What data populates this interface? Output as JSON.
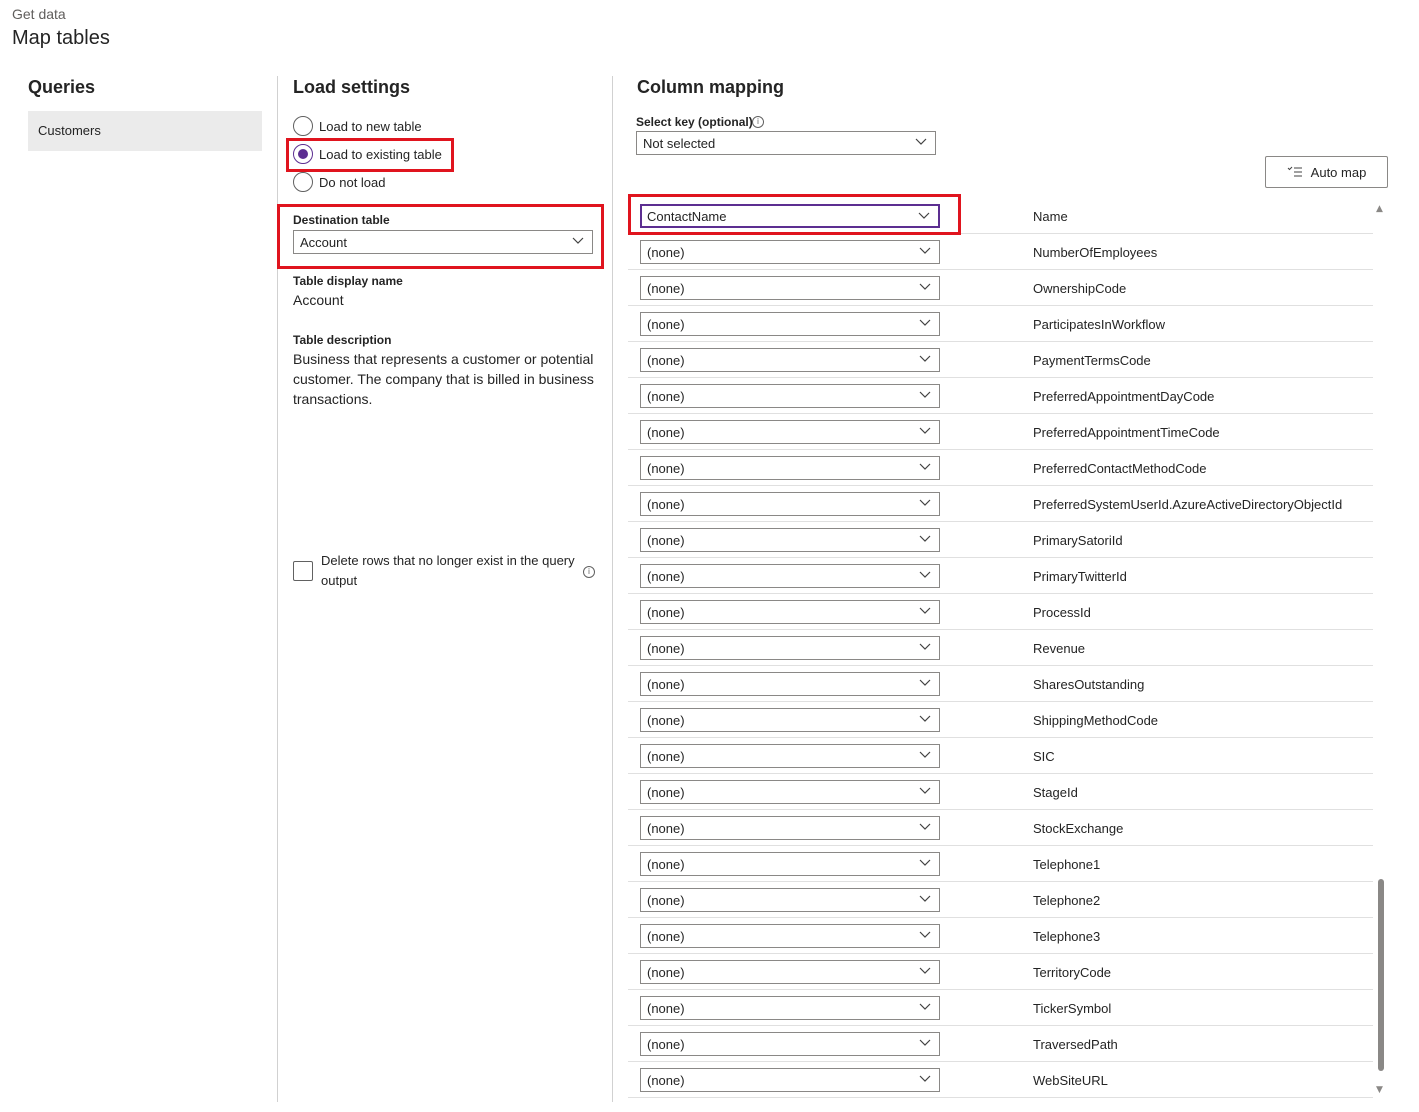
{
  "header": {
    "breadcrumb": "Get data",
    "title": "Map tables"
  },
  "queries": {
    "title": "Queries",
    "items": [
      "Customers"
    ]
  },
  "load_settings": {
    "title": "Load settings",
    "options": [
      {
        "label": "Load to new table",
        "checked": false
      },
      {
        "label": "Load to existing table",
        "checked": true
      },
      {
        "label": "Do not load",
        "checked": false
      }
    ],
    "destination_label": "Destination table",
    "destination_value": "Account",
    "display_name_label": "Table display name",
    "display_name_value": "Account",
    "description_label": "Table description",
    "description_value": "Business that represents a customer or potential customer. The company that is billed in business transactions.",
    "delete_rows_label": "Delete rows that no longer exist in the query output",
    "delete_rows_checked": false
  },
  "column_mapping": {
    "title": "Column mapping",
    "select_key_label": "Select key (optional)",
    "select_key_value": "Not selected",
    "auto_map_label": "Auto map",
    "rows": [
      {
        "source": "ContactName",
        "target": "Name"
      },
      {
        "source": "(none)",
        "target": "NumberOfEmployees"
      },
      {
        "source": "(none)",
        "target": "OwnershipCode"
      },
      {
        "source": "(none)",
        "target": "ParticipatesInWorkflow"
      },
      {
        "source": "(none)",
        "target": "PaymentTermsCode"
      },
      {
        "source": "(none)",
        "target": "PreferredAppointmentDayCode"
      },
      {
        "source": "(none)",
        "target": "PreferredAppointmentTimeCode"
      },
      {
        "source": "(none)",
        "target": "PreferredContactMethodCode"
      },
      {
        "source": "(none)",
        "target": "PreferredSystemUserId.AzureActiveDirectoryObjectId"
      },
      {
        "source": "(none)",
        "target": "PrimarySatoriId"
      },
      {
        "source": "(none)",
        "target": "PrimaryTwitterId"
      },
      {
        "source": "(none)",
        "target": "ProcessId"
      },
      {
        "source": "(none)",
        "target": "Revenue"
      },
      {
        "source": "(none)",
        "target": "SharesOutstanding"
      },
      {
        "source": "(none)",
        "target": "ShippingMethodCode"
      },
      {
        "source": "(none)",
        "target": "SIC"
      },
      {
        "source": "(none)",
        "target": "StageId"
      },
      {
        "source": "(none)",
        "target": "StockExchange"
      },
      {
        "source": "(none)",
        "target": "Telephone1"
      },
      {
        "source": "(none)",
        "target": "Telephone2"
      },
      {
        "source": "(none)",
        "target": "Telephone3"
      },
      {
        "source": "(none)",
        "target": "TerritoryCode"
      },
      {
        "source": "(none)",
        "target": "TickerSymbol"
      },
      {
        "source": "(none)",
        "target": "TraversedPath"
      },
      {
        "source": "(none)",
        "target": "WebSiteURL"
      }
    ]
  },
  "colors": {
    "accent": "#5c2e91",
    "highlight": "#e0141e"
  }
}
